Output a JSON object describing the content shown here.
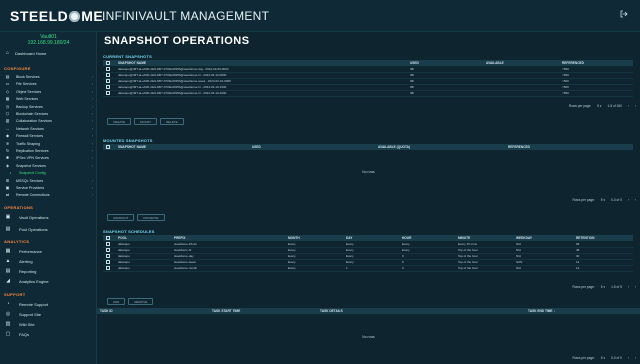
{
  "header": {
    "logo_left": "STEELD",
    "logo_right": "ME",
    "title": "INFINIVAULT MANAGEMENT",
    "logout_icon": "logout-icon"
  },
  "sidebar": {
    "vault_name": "Vault01",
    "vault_ip": "192.168.99.180/24",
    "dashboard": "Dashboard Home",
    "configure_label": "CONFIGURE",
    "configure_items": [
      {
        "label": "Block Services",
        "icon": "block-icon"
      },
      {
        "label": "File Services",
        "icon": "file-icon"
      },
      {
        "label": "Object Services",
        "icon": "object-icon"
      },
      {
        "label": "Web Services",
        "icon": "web-icon"
      },
      {
        "label": "Backup Services",
        "icon": "backup-icon"
      },
      {
        "label": "Blockchain Services",
        "icon": "blockchain-icon"
      },
      {
        "label": "Collaboration Services",
        "icon": "collab-icon"
      },
      {
        "label": "Network Services",
        "icon": "network-icon"
      },
      {
        "label": "Firewall Services",
        "icon": "firewall-icon"
      },
      {
        "label": "Traffic Shaping",
        "icon": "traffic-icon"
      },
      {
        "label": "Replication Services",
        "icon": "replication-icon"
      },
      {
        "label": "IPSec VPN Services",
        "icon": "vpn-icon"
      },
      {
        "label": "Snapshot Services",
        "icon": "snapshot-icon"
      },
      {
        "label": "Snapshot Config",
        "icon": "",
        "sub": true
      },
      {
        "label": "MSSQL Services",
        "icon": "mssql-icon"
      },
      {
        "label": "Service Providers",
        "icon": "provider-icon"
      },
      {
        "label": "Remote Connections",
        "icon": "remote-icon"
      }
    ],
    "operations_label": "OPERATIONS",
    "operations_items": [
      "Vault Operations",
      "Pool Operations"
    ],
    "analytics_label": "ANALYTICS",
    "analytics_items": [
      "Performance",
      "Alerting",
      "Reporting",
      "Analytics Engine"
    ],
    "support_label": "SUPPORT",
    "support_items": [
      "Remote Support",
      "Support Site",
      "Wiki Site",
      "FAQs"
    ]
  },
  "page": {
    "title": "SNAPSHOT OPERATIONS"
  },
  "current": {
    "title": "CURRENT SNAPSHOTS",
    "columns": [
      "SNAPSHOT NAME",
      "USED",
      "AVAILABLE",
      "REFERENCED"
    ],
    "rows": [
      [
        "datarepo@tMT-at-e606-4fe9-96f7-0709e0035b@steeldome-day...2024-03-09-0000",
        "0B",
        "",
        "<50K"
      ],
      [
        "datarepo@tMT-at-e606-4fe9-96f7-0709e0035b@steeldome-hr...2024-03-10-0000",
        "0B",
        "",
        "<50K"
      ],
      [
        "datarepo@tMT-at-e606-4fe9-96f7-0709e0035b@steeldome-week...2024-03-10-0000",
        "0B",
        "",
        "<50K"
      ],
      [
        "datarepo@tMT-at-e606-4fe9-96f7-0709e0035b@steeldome-hr...2024-03-10-1900",
        "0B",
        "",
        "<50K"
      ],
      [
        "datarepo@tMT-at-e606-4fe9-96f7-0709e0035b@steeldome-hr...2024-03-10-2000",
        "0B",
        "",
        "<50K"
      ]
    ],
    "rows_per_page_label": "Rows per page:",
    "rows_per_page": "5",
    "range": "1-5 of 160",
    "buttons": [
      "CREATE",
      "MOUNT",
      "DELETE"
    ]
  },
  "mounted": {
    "title": "MOUNTED SNAPSHOTS",
    "columns": [
      "SNAPSHOT NAME",
      "USED",
      "AVAILABLE (QUOTA)",
      "REFERENCED"
    ],
    "empty": "No rows",
    "rows_per_page_label": "Rows per page:",
    "rows_per_page": "5",
    "range": "0-0 of 0",
    "buttons": [
      "UNMOUNT",
      "PROMOTE"
    ]
  },
  "schedules": {
    "title": "SNAPSHOT SCHEDULES",
    "columns": [
      "POOL",
      "PREFIX",
      "MONTH",
      "DAY",
      "HOUR",
      "MINUTE",
      "WEEKDAY",
      "RETENTION"
    ],
    "rows": [
      [
        "datarepo",
        "steeldome-15min",
        "Every",
        "Every",
        "Every",
        "Every 15 mins",
        "N/A",
        "96"
      ],
      [
        "datarepo",
        "steeldome-hr",
        "Every",
        "Every",
        "Every",
        "Top of the hour",
        "N/A",
        "48"
      ],
      [
        "datarepo",
        "steeldome-day",
        "Every",
        "Every",
        "0",
        "Top of the hour",
        "N/A",
        "30"
      ],
      [
        "datarepo",
        "steeldome-week",
        "Every",
        "Every",
        "0",
        "Top of the hour",
        "SUN",
        "12"
      ],
      [
        "datarepo",
        "steeldome-month",
        "Every",
        "1",
        "0",
        "Top of the hour",
        "N/A",
        "12"
      ]
    ],
    "rows_per_page_label": "Rows per page:",
    "rows_per_page": "5",
    "range": "1-5 of 5",
    "buttons": [
      "ADD",
      "REMOVE"
    ]
  },
  "tasks": {
    "columns": [
      "TASK ID",
      "TASK START TIME",
      "TASK DETAILS",
      "TASK END TIME"
    ],
    "empty": "No rows",
    "rows_per_page_label": "Rows per page:",
    "rows_per_page": "5",
    "range": "0-0 of 0"
  },
  "colors": {
    "accent_green": "#3ddc84",
    "section_orange": "#ff8a3d",
    "title_cyan": "#79d8f0",
    "background": "#0e2530"
  }
}
